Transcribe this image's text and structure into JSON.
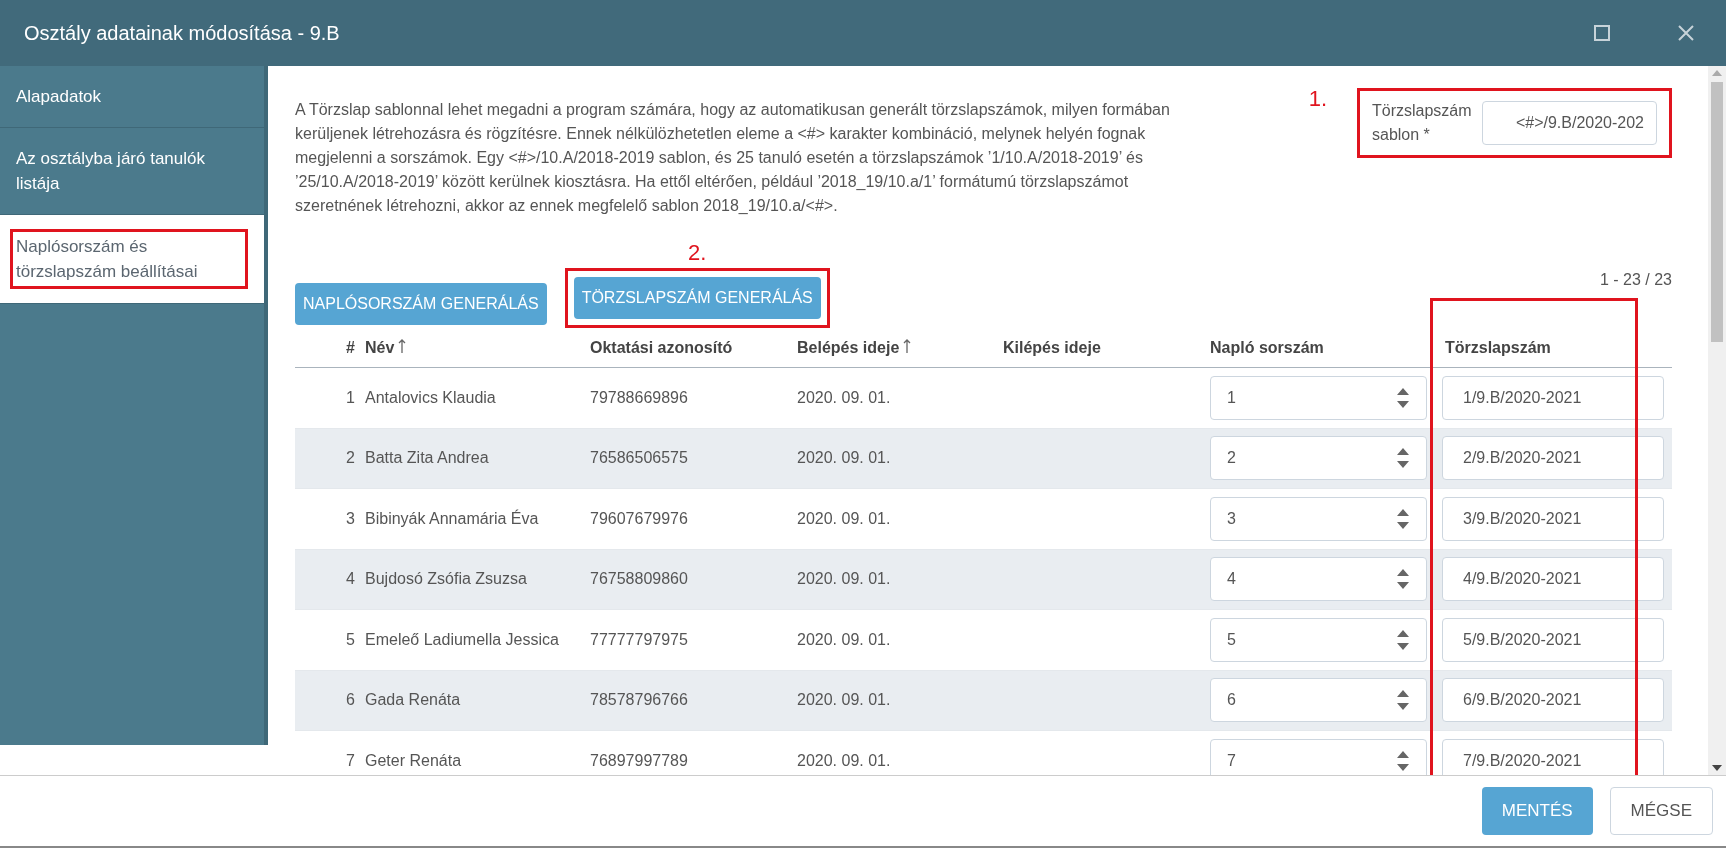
{
  "window": {
    "title": "Osztály adatainak módosítása - 9.B"
  },
  "sidebar": {
    "items": [
      {
        "label": "Alapadatok",
        "selected": false,
        "highlighted": false
      },
      {
        "label": "Az osztályba járó tanulók listája",
        "selected": false,
        "highlighted": false
      },
      {
        "label": "Naplósorszám és törzslapszám beállításai",
        "selected": true,
        "highlighted": true
      }
    ]
  },
  "description": "A Törzslap sablonnal lehet megadni a program számára, hogy az automatikusan generált törzslapszámok, milyen formában kerüljenek létrehozásra és rögzítésre. Ennek nélkülözhetetlen eleme a <#> karakter kombináció, melynek helyén fognak megjelenni a sorszámok. Egy <#>/10.A/2018-2019 sablon, és 25 tanuló esetén a törzslapszámok ’1/10.A/2018-2019’ és ’25/10.A/2018-2019’ között kerülnek kiosztásra. Ha ettől eltérően, például ’2018_19/10.a/1’ formátumú törzslapszámot szeretnének létrehozni, akkor az ennek megfelelő sablon 2018_19/10.a/<#>.",
  "template_field": {
    "marker": "1.",
    "label": "Törzslapszám sablon *",
    "value": "<#>/9.B/2020-202",
    "highlighted": true
  },
  "buttons": [
    {
      "label": "NAPLÓSORSZÁM GENERÁLÁS",
      "highlighted": false
    },
    {
      "label": "TÖRZSLAPSZÁM GENERÁLÁS",
      "highlighted": true,
      "marker": "2."
    }
  ],
  "pager": "1 - 23 / 23",
  "table": {
    "columns": [
      {
        "label": "#",
        "sorted": false,
        "highlighted": false
      },
      {
        "label": "Név",
        "sorted": true,
        "highlighted": false
      },
      {
        "label": "Oktatási azonosító",
        "sorted": false,
        "highlighted": false
      },
      {
        "label": "Belépés ideje",
        "sorted": true,
        "highlighted": false
      },
      {
        "label": "Kilépés ideje",
        "sorted": false,
        "highlighted": false
      },
      {
        "label": "Napló sorszám",
        "sorted": false,
        "highlighted": false
      },
      {
        "label": "Törzslapszám",
        "sorted": false,
        "highlighted": true
      }
    ],
    "rows": [
      {
        "index": "1",
        "name": "Antalovics Klaudia",
        "id": "79788669896",
        "entry_date": "2020. 09. 01.",
        "journal_no": "1",
        "register_no": "1/9.B/2020-2021"
      },
      {
        "index": "2",
        "name": "Batta Zita Andrea",
        "id": "76586506575",
        "entry_date": "2020. 09. 01.",
        "journal_no": "2",
        "register_no": "2/9.B/2020-2021"
      },
      {
        "index": "3",
        "name": "Bibinyák Annamária Éva",
        "id": "79607679976",
        "entry_date": "2020. 09. 01.",
        "journal_no": "3",
        "register_no": "3/9.B/2020-2021"
      },
      {
        "index": "4",
        "name": "Bujdosó Zsófia Zsuzsa",
        "id": "76758809860",
        "entry_date": "2020. 09. 01.",
        "journal_no": "4",
        "register_no": "4/9.B/2020-2021"
      },
      {
        "index": "5",
        "name": "Emeleő Ladiumella Jessica",
        "id": "77777797975",
        "entry_date": "2020. 09. 01.",
        "journal_no": "5",
        "register_no": "5/9.B/2020-2021"
      },
      {
        "index": "6",
        "name": "Gada Renáta",
        "id": "78578796766",
        "entry_date": "2020. 09. 01.",
        "journal_no": "6",
        "register_no": "6/9.B/2020-2021"
      },
      {
        "index": "7",
        "name": "Geter Renáta",
        "id": "76897997789",
        "entry_date": "2020. 09. 01.",
        "journal_no": "7",
        "register_no": "7/9.B/2020-2021"
      }
    ]
  },
  "footer": {
    "buttons": [
      {
        "label": "MENTÉS",
        "kind": "primary"
      },
      {
        "label": "MÉGSE",
        "kind": "secondary"
      }
    ]
  }
}
